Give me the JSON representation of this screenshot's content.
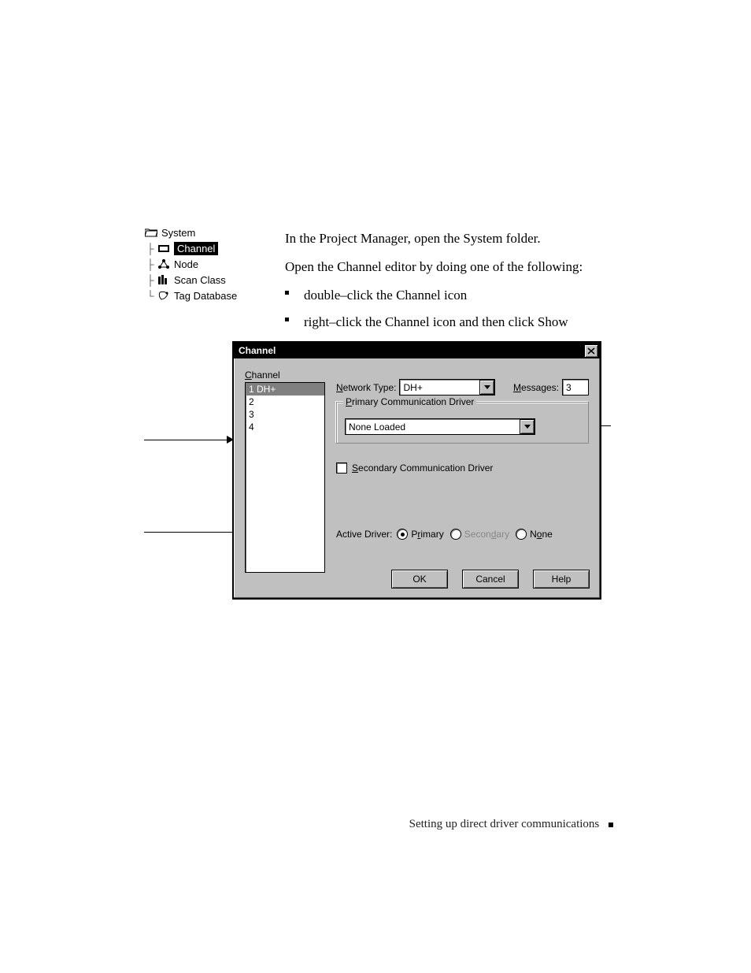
{
  "body": {
    "p1": "In the Project Manager, open the System folder.",
    "p2": "Open the Channel editor by doing one of the following:",
    "b1": "double–click the Channel icon",
    "b2": "right–click the Channel icon and then click Show"
  },
  "tree": {
    "root": "System",
    "items": [
      "Channel",
      "Node",
      "Scan Class",
      "Tag Database"
    ]
  },
  "dialog": {
    "title": "Channel",
    "channel_label": "Channel",
    "list": [
      "1   DH+",
      "2",
      "3",
      "4"
    ],
    "network_type_label": "Network Type:",
    "network_type_value": "DH+",
    "messages_label": "Messages:",
    "messages_value": "3",
    "primary_group": "Primary Communication Driver",
    "primary_value": "None Loaded",
    "secondary_checkbox": "Secondary Communication Driver",
    "active_driver_label": "Active Driver:",
    "radio_primary": "Primary",
    "radio_secondary": "Secondary",
    "radio_none": "None",
    "ok": "OK",
    "cancel": "Cancel",
    "help": "Help"
  },
  "footer": "Setting up direct driver communications"
}
